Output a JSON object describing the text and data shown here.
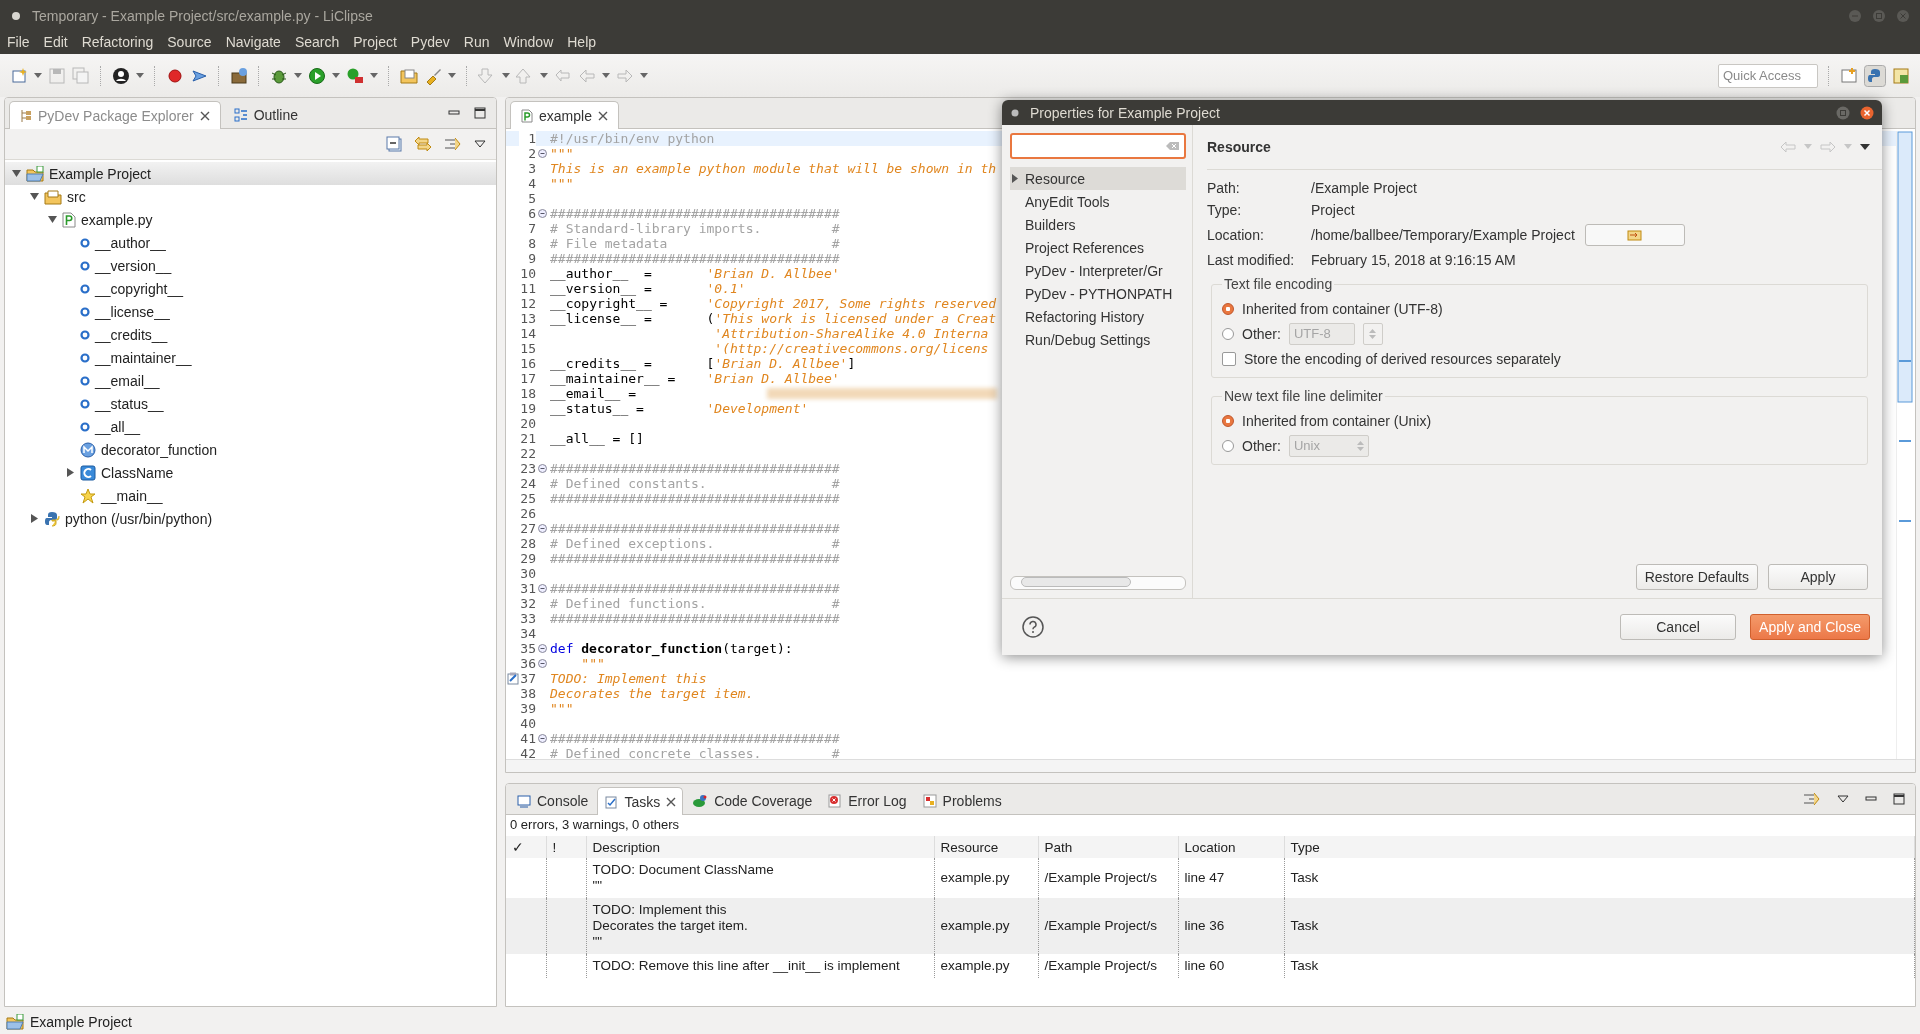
{
  "window": {
    "title": "Temporary - Example Project/src/example.py - LiClipse"
  },
  "menu": [
    "File",
    "Edit",
    "Refactoring",
    "Source",
    "Navigate",
    "Search",
    "Project",
    "Pydev",
    "Run",
    "Window",
    "Help"
  ],
  "quick_access": {
    "placeholder": "Quick Access"
  },
  "explorer": {
    "tabs": [
      {
        "label": "PyDev Package Explorer",
        "selected": true
      },
      {
        "label": "Outline",
        "selected": false
      }
    ],
    "tree": [
      {
        "label": "Example Project",
        "kind": "project",
        "expanded": true,
        "selected": true,
        "children": [
          {
            "label": "src",
            "kind": "folder",
            "expanded": true,
            "selected": false,
            "children": [
              {
                "label": "example.py",
                "kind": "pyfile",
                "expanded": true,
                "selected": false,
                "children": [
                  {
                    "label": "__author__",
                    "kind": "variable",
                    "selected": false
                  },
                  {
                    "label": "__version__",
                    "kind": "variable",
                    "selected": false
                  },
                  {
                    "label": "__copyright__",
                    "kind": "variable",
                    "selected": false
                  },
                  {
                    "label": "__license__",
                    "kind": "variable",
                    "selected": false
                  },
                  {
                    "label": "__credits__",
                    "kind": "variable",
                    "selected": false
                  },
                  {
                    "label": "__maintainer__",
                    "kind": "variable",
                    "selected": false
                  },
                  {
                    "label": "__email__",
                    "kind": "variable",
                    "selected": false
                  },
                  {
                    "label": "__status__",
                    "kind": "variable",
                    "selected": false
                  },
                  {
                    "label": "__all__",
                    "kind": "variable",
                    "selected": false
                  },
                  {
                    "label": "decorator_function",
                    "kind": "function",
                    "selected": false
                  },
                  {
                    "label": "ClassName",
                    "kind": "class",
                    "expanded": false,
                    "selected": false
                  },
                  {
                    "label": "__main__",
                    "kind": "main",
                    "selected": false
                  }
                ]
              }
            ]
          },
          {
            "label": "python  (/usr/bin/python)",
            "kind": "interpreter",
            "expanded": false,
            "selected": false
          }
        ]
      }
    ]
  },
  "editor": {
    "tabs": [
      {
        "label": "example",
        "selected": true
      }
    ],
    "lines": [
      {
        "number": "1",
        "current": true,
        "segments": [
          {
            "kind": "comment",
            "text": "#!/usr/bin/env python"
          }
        ]
      },
      {
        "number": "2",
        "fold": true,
        "segments": [
          {
            "kind": "docstring",
            "text": "\"\"\""
          }
        ]
      },
      {
        "number": "3",
        "segments": [
          {
            "kind": "docstring",
            "text": "This is an example python module that will be shown in th"
          }
        ]
      },
      {
        "number": "4",
        "segments": [
          {
            "kind": "docstring",
            "text": "\"\"\""
          }
        ]
      },
      {
        "number": "5"
      },
      {
        "number": "6",
        "fold": true,
        "segments": [
          {
            "kind": "comment",
            "text": "#####################################"
          }
        ]
      },
      {
        "number": "7",
        "segments": [
          {
            "kind": "comment",
            "text": "# Standard-library imports.         #"
          }
        ]
      },
      {
        "number": "8",
        "segments": [
          {
            "kind": "comment",
            "text": "# File metadata                     #"
          }
        ]
      },
      {
        "number": "9",
        "segments": [
          {
            "kind": "comment",
            "text": "#####################################"
          }
        ]
      },
      {
        "number": "10",
        "segments": [
          {
            "kind": "code",
            "text": "__author__  =       "
          },
          {
            "kind": "string",
            "text": "'Brian D. Allbee'"
          }
        ]
      },
      {
        "number": "11",
        "segments": [
          {
            "kind": "code",
            "text": "__version__ =       "
          },
          {
            "kind": "string",
            "text": "'0.1'"
          }
        ]
      },
      {
        "number": "12",
        "segments": [
          {
            "kind": "code",
            "text": "__copyright__ =     "
          },
          {
            "kind": "string",
            "text": "'Copyright 2017, Some rights reserved"
          }
        ]
      },
      {
        "number": "13",
        "segments": [
          {
            "kind": "code",
            "text": "__license__ =       ("
          },
          {
            "kind": "string",
            "text": "'This work is licensed under a Creat"
          }
        ]
      },
      {
        "number": "14",
        "continued": true,
        "segments": [
          {
            "kind": "string",
            "text": "'Attribution-ShareAlike 4.0 Interna"
          }
        ]
      },
      {
        "number": "15",
        "continued": true,
        "segments": [
          {
            "kind": "string",
            "text": "'(http://creativecommons.org/licens"
          }
        ]
      },
      {
        "number": "16",
        "segments": [
          {
            "kind": "code",
            "text": "__credits__ =       ["
          },
          {
            "kind": "string",
            "text": "'Brian D. Allbee'"
          },
          {
            "kind": "code",
            "text": "]"
          }
        ]
      },
      {
        "number": "17",
        "segments": [
          {
            "kind": "code",
            "text": "__maintainer__ =    "
          },
          {
            "kind": "string",
            "text": "'Brian D. Allbee'"
          }
        ]
      },
      {
        "number": "18",
        "blurred": true,
        "segments": [
          {
            "kind": "code",
            "text": "__email__ =         "
          }
        ]
      },
      {
        "number": "19",
        "segments": [
          {
            "kind": "code",
            "text": "__status__ =        "
          },
          {
            "kind": "string",
            "text": "'Development'"
          }
        ]
      },
      {
        "number": "20"
      },
      {
        "number": "21",
        "segments": [
          {
            "kind": "code",
            "text": "__all__ = []"
          }
        ]
      },
      {
        "number": "22"
      },
      {
        "number": "23",
        "fold": true,
        "segments": [
          {
            "kind": "comment",
            "text": "#####################################"
          }
        ]
      },
      {
        "number": "24",
        "segments": [
          {
            "kind": "comment",
            "text": "# Defined constants.                #"
          }
        ]
      },
      {
        "number": "25",
        "segments": [
          {
            "kind": "comment",
            "text": "#####################################"
          }
        ]
      },
      {
        "number": "26"
      },
      {
        "number": "27",
        "fold": true,
        "segments": [
          {
            "kind": "comment",
            "text": "#####################################"
          }
        ]
      },
      {
        "number": "28",
        "segments": [
          {
            "kind": "comment",
            "text": "# Defined exceptions.               #"
          }
        ]
      },
      {
        "number": "29",
        "segments": [
          {
            "kind": "comment",
            "text": "#####################################"
          }
        ]
      },
      {
        "number": "30"
      },
      {
        "number": "31",
        "fold": true,
        "segments": [
          {
            "kind": "comment",
            "text": "#####################################"
          }
        ]
      },
      {
        "number": "32",
        "segments": [
          {
            "kind": "comment",
            "text": "# Defined functions.                #"
          }
        ]
      },
      {
        "number": "33",
        "segments": [
          {
            "kind": "comment",
            "text": "#####################################"
          }
        ]
      },
      {
        "number": "34"
      },
      {
        "number": "35",
        "fold": true,
        "segments": [
          {
            "kind": "keyword",
            "text": "def"
          },
          {
            "kind": "function",
            "text": "decorator_function"
          },
          {
            "kind": "code",
            "text": "(target):"
          }
        ]
      },
      {
        "number": "36",
        "fold": true,
        "segments": [
          {
            "kind": "docstring",
            "text": "    \"\"\""
          }
        ]
      },
      {
        "number": "37",
        "task": true,
        "segments": [
          {
            "kind": "docstring",
            "text": "TODO: Implement this"
          }
        ]
      },
      {
        "number": "38",
        "segments": [
          {
            "kind": "docstring",
            "text": "Decorates the target item."
          }
        ]
      },
      {
        "number": "39",
        "segments": [
          {
            "kind": "docstring",
            "text": "\"\"\""
          }
        ]
      },
      {
        "number": "40"
      },
      {
        "number": "41",
        "fold": true,
        "segments": [
          {
            "kind": "comment",
            "text": "#####################################"
          }
        ]
      },
      {
        "number": "42",
        "segments": [
          {
            "kind": "comment",
            "text": "# Defined concrete classes.         #"
          }
        ]
      }
    ]
  },
  "dialog": {
    "title": "Properties for Example Project",
    "search": {
      "focused": true
    },
    "nav": [
      {
        "label": "Resource",
        "selected": true,
        "expanded": false
      },
      {
        "label": "AnyEdit Tools",
        "selected": false
      },
      {
        "label": "Builders",
        "selected": false
      },
      {
        "label": "Project References",
        "selected": false
      },
      {
        "label": "PyDev - Interpreter/Gr",
        "selected": false
      },
      {
        "label": "PyDev - PYTHONPATH",
        "selected": false
      },
      {
        "label": "Refactoring History",
        "selected": false
      },
      {
        "label": "Run/Debug Settings",
        "selected": false
      }
    ],
    "page_title": "Resource",
    "properties": [
      {
        "label": "Path:",
        "value": "/Example Project"
      },
      {
        "label": "Type:",
        "value": "Project"
      },
      {
        "label": "Location:",
        "value": "/home/ballbee/Temporary/Example Project",
        "kind": "location"
      },
      {
        "label": "Last modified:",
        "value": "February 15, 2018 at 9:16:15 AM"
      }
    ],
    "groups": [
      {
        "title": "Text file encoding",
        "options": [
          {
            "label": "Inherited from container (UTF-8)",
            "selected": true
          },
          {
            "label": "Other:",
            "selected": false,
            "field": {
              "kind": "spinner",
              "value": "UTF-8",
              "disabled": true
            }
          }
        ],
        "checkbox": {
          "label": "Store the encoding of derived resources separately",
          "checked": false
        }
      },
      {
        "title": "New text file line delimiter",
        "options": [
          {
            "label": "Inherited from container (Unix)",
            "selected": true
          },
          {
            "label": "Other:",
            "selected": false,
            "field": {
              "kind": "combo",
              "value": "Unix",
              "disabled": true
            }
          }
        ]
      }
    ],
    "page_buttons": [
      {
        "label": "Restore Defaults"
      },
      {
        "label": "Apply"
      }
    ],
    "buttons": [
      {
        "label": "Cancel",
        "kind": "default"
      },
      {
        "label": "Apply and Close",
        "kind": "primary"
      }
    ]
  },
  "tasks": {
    "tabs": [
      {
        "label": "Console",
        "selected": false
      },
      {
        "label": "Tasks",
        "selected": true
      },
      {
        "label": "Code Coverage",
        "selected": false
      },
      {
        "label": "Error Log",
        "selected": false
      },
      {
        "label": "Problems",
        "selected": false
      }
    ],
    "summary": "0 errors, 3 warnings, 0 others",
    "columns": [
      "✓",
      "!",
      "Description",
      "Resource",
      "Path",
      "Location",
      "Type"
    ],
    "rows": [
      [
        "",
        "",
        "TODO: Document ClassName\n\"\"",
        "example.py",
        "/Example Project/s",
        "line 47",
        "Task"
      ],
      [
        "",
        "",
        "TODO: Implement this\nDecorates the target item.\n\"\"",
        "example.py",
        "/Example Project/s",
        "line 36",
        "Task"
      ],
      [
        "",
        "",
        "TODO: Remove this line after __init__ is implement",
        "example.py",
        "/Example Project/s",
        "line 60",
        "Task"
      ]
    ]
  },
  "status_bar": {
    "text": "Example Project"
  }
}
